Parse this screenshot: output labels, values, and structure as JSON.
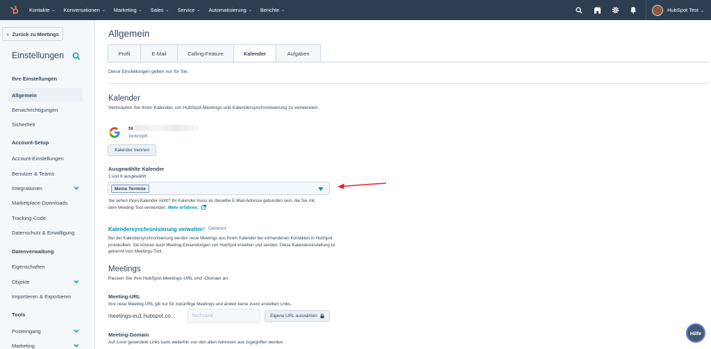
{
  "topnav": {
    "items": [
      "Kontakte",
      "Konversationen",
      "Marketing",
      "Sales",
      "Service",
      "Automatisierung",
      "Berichte"
    ],
    "account_name": "HubSpot Test",
    "colors": {
      "bg": "#2d3e50",
      "logo": "#ff7a59"
    }
  },
  "sidebar": {
    "back_label": "Zurück zu Meetings",
    "title": "Einstellungen",
    "sections": {
      "ihre": "Ihre Einstellungen",
      "account": "Account-Setup",
      "daten": "Datenverwaltung",
      "tools": "Tools"
    },
    "items": {
      "allgemein": "Allgemein",
      "benachrichtigungen": "Benachrichtigungen",
      "sicherheit": "Sicherheit",
      "account_einstellungen": "Account-Einstellungen",
      "benutzer": "Benutzer & Teams",
      "integrationen": "Integrationen",
      "marketplace": "Marketplace-Downloads",
      "tracking": "Tracking-Code",
      "datenschutz": "Datenschutz & Einwilligung",
      "eigenschaften": "Eigenschaften",
      "objekte": "Objekte",
      "importieren": "Importieren & Exportieren",
      "posteingang": "Posteingang",
      "marketing": "Marketing"
    }
  },
  "main": {
    "page_title": "Allgemein",
    "tabs": [
      "Profil",
      "E-Mail",
      "Calling-Feature",
      "Kalender",
      "Aufgaben"
    ],
    "active_tab": "Kalender",
    "tab_note": "Diese Einstellungen gelten nur für Sie.",
    "kalender": {
      "title": "Kalender",
      "subtitle": "Verknüpfen Sie Ihren Kalender, um HubSpot-Meetings und Kalendersynchronisierung zu verwenden.",
      "account_prefix": "ta",
      "account_status": "Verknüpft",
      "disconnect_label": "Kalender trennen",
      "selected_label": "Ausgewählte Kalender",
      "selected_count": "1 von 6 ausgewählt",
      "selected_tag": "Meine Termine",
      "help_line1": "Sie sehen Ihren Kalender nicht? Ihr Kalender muss an dieselbe E-Mail-Adresse gebunden sein, die Sie mit",
      "help_line2_prefix": "dem Meeting-Tool verwenden. ",
      "help_link": "Mehr erfahren."
    },
    "sync": {
      "title": "Kalendersynchronisierung verwalten",
      "status": "Getrennt",
      "desc": "Bei der Kalendersynchronisierung werden neue Meetings aus Ihrem Kalender bei vorhandenen Kontakten in HubSpot protokolliert. Sie können auch Meeting-Einsendungen von HubSpot erstellen und senden. Diese Kalendereinstellung ist getrennt vom Meetings-Tool."
    },
    "meetings": {
      "title": "Meetings",
      "subtitle": "Passen Sie Ihre HubSpot-Meetings-URL und -Domain an.",
      "url_label": "Meeting-URL",
      "url_note": "Ihre neue Meeting-URL gilt nur für zukünftige Meetings und ändert keine zuvor erstellten Links.",
      "url_prefix": "meetings-eu1.hubspot.co...",
      "url_placeholder": "hschrazal",
      "url_button": "Eigene URL auswählen",
      "domain_label": "Meeting-Domain",
      "domain_note": "Auf zuvor gesendete Links kann weiterhin von den alten Adressen aus zugegriffen werden."
    },
    "help_button": "Hilfe"
  }
}
